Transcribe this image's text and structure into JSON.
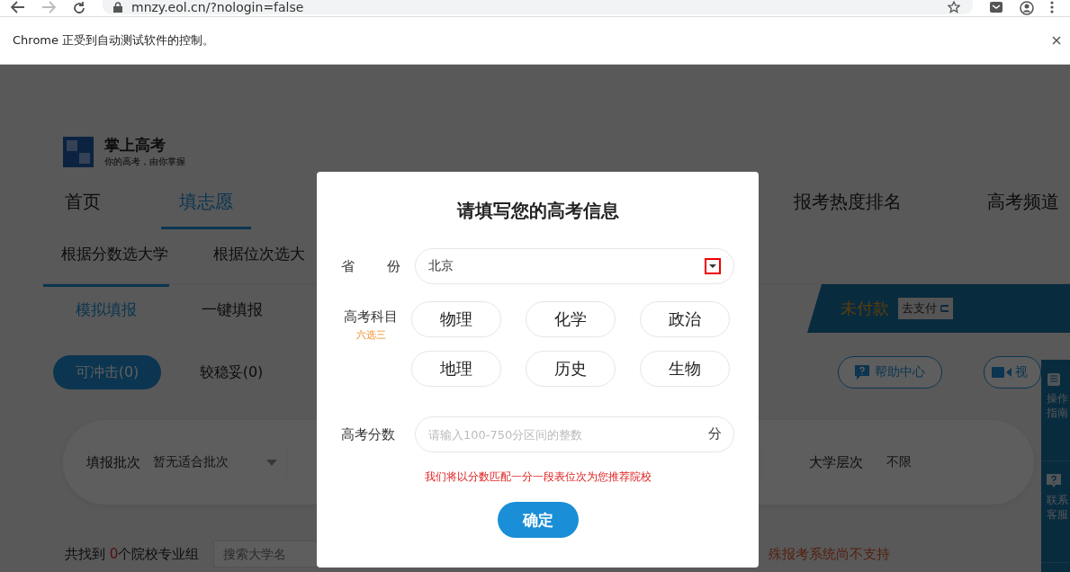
{
  "browser": {
    "url": "mnzy.eol.cn/?nologin=false",
    "infobar": "Chrome 正受到自动测试软件的控制。"
  },
  "site": {
    "logo_title": "掌上高考",
    "logo_slogan": "你的高考，由你掌握",
    "nav_left": [
      {
        "label": "首页",
        "selected": false
      },
      {
        "label": "填志愿",
        "selected": true
      }
    ],
    "nav_right": [
      {
        "label": "报考热度排名",
        "selected": false
      },
      {
        "label": "高考频道",
        "selected": false
      }
    ],
    "subnav": [
      "根据分数选大学",
      "根据位次选大"
    ],
    "subtabs": [
      {
        "label": "模拟填报",
        "selected": true
      },
      {
        "label": "一键填报",
        "selected": false
      }
    ],
    "payment": {
      "status": "未付款",
      "button": "去支付"
    },
    "pills": [
      {
        "label": "可冲击(0)",
        "selected": true
      },
      {
        "label": "较稳妥(0)",
        "selected": false
      }
    ],
    "help_buttons": [
      {
        "kind": "help",
        "label": "帮助中心"
      },
      {
        "kind": "video",
        "label": "视"
      }
    ],
    "filters": [
      {
        "label": "填报批次",
        "value": "暂无适合批次"
      },
      {
        "label": "大学层次",
        "value": "不限"
      }
    ],
    "results": {
      "prefix": "共找到 ",
      "count": "0",
      "suffix": "个院校专业组"
    },
    "search_placeholder": "搜索大学名",
    "notice": "殊报考系统尚不支持",
    "side_panel": [
      {
        "kind": "guide",
        "label": "操作指南"
      },
      {
        "kind": "service",
        "label": "联系客服"
      }
    ]
  },
  "modal": {
    "title": "请填写您的高考信息",
    "province_label": "省 份",
    "province_value": "北京",
    "subjects_label": "高考科目",
    "subjects_hint": "六选三",
    "subjects": [
      {
        "label": "物理",
        "selected": false
      },
      {
        "label": "化学",
        "selected": false
      },
      {
        "label": "政治",
        "selected": false
      },
      {
        "label": "地理",
        "selected": false
      },
      {
        "label": "历史",
        "selected": false
      },
      {
        "label": "生物",
        "selected": false
      }
    ],
    "score_label": "高考分数",
    "score_placeholder": "请输入100-750分区间的整数",
    "score_unit": "分",
    "note": "我们将以分数匹配一分一段表位次为您推荐院校",
    "confirm": "确定"
  }
}
